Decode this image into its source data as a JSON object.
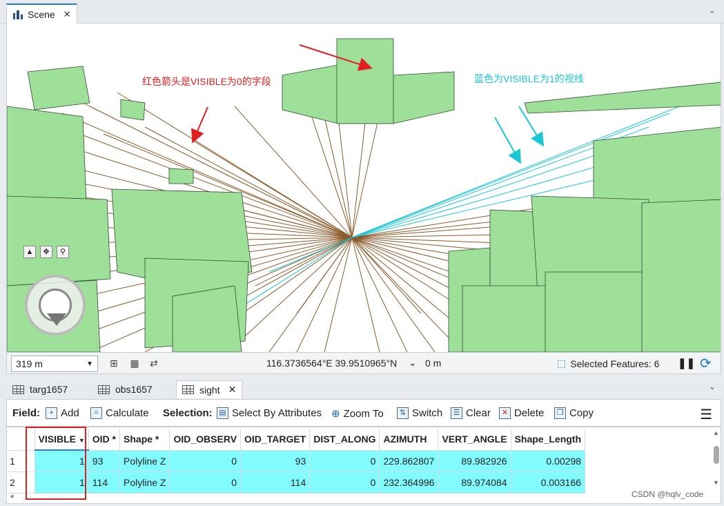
{
  "window": {
    "tab_title": "Scene",
    "close_glyph": "✕",
    "chevron_glyph": "⌄"
  },
  "annotations": {
    "red_text": "红色箭头是VISIBLE为0的字段",
    "cyan_text": "蓝色为VISIBLE为1的视线"
  },
  "status": {
    "scale": "319 m",
    "coordinates": "116.3736564°E 39.9510965°N",
    "elevation": "0 m",
    "selected_features": "Selected Features: 6"
  },
  "table_tabs": [
    {
      "label": "targ1657"
    },
    {
      "label": "obs1657"
    },
    {
      "label": "sight"
    }
  ],
  "toolbar": {
    "field_label": "Field:",
    "add": "Add",
    "calculate": "Calculate",
    "selection_label": "Selection:",
    "select_by_attributes": "Select By Attributes",
    "zoom_to": "Zoom To",
    "switch": "Switch",
    "clear": "Clear",
    "delete": "Delete",
    "copy": "Copy"
  },
  "grid": {
    "columns": [
      "VISIBLE",
      "OID *",
      "Shape *",
      "OID_OBSERV",
      "OID_TARGET",
      "DIST_ALONG",
      "AZIMUTH",
      "VERT_ANGLE",
      "Shape_Length"
    ],
    "rows": [
      {
        "rn": "1",
        "VISIBLE": "1",
        "OID": "93",
        "Shape": "Polyline Z",
        "OID_OBSERV": "0",
        "OID_TARGET": "93",
        "DIST_ALONG": "0",
        "AZIMUTH": "229.862807",
        "VERT_ANGLE": "89.982926",
        "Shape_Length": "0.00298"
      },
      {
        "rn": "2",
        "VISIBLE": "1",
        "OID": "114",
        "Shape": "Polyline Z",
        "OID_OBSERV": "0",
        "OID_TARGET": "114",
        "DIST_ALONG": "0",
        "AZIMUTH": "232.364996",
        "VERT_ANGLE": "89.974084",
        "Shape_Length": "0.003166"
      }
    ]
  },
  "watermark": "CSDN @hqlv_code",
  "colors": {
    "building": "#9ee09a",
    "building_edge": "#2d4a2d",
    "sightline_invisible": "#8b5a2b",
    "sightline_visible": "#19c6d6",
    "annotation_red": "#e02020",
    "annotation_cyan": "#19c6d6",
    "row_highlight": "#82fbff"
  }
}
